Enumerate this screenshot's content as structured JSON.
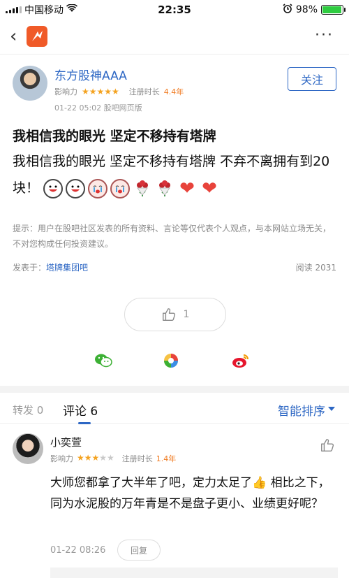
{
  "status_bar": {
    "carrier": "中国移动",
    "time": "22:35",
    "battery": "98%",
    "battery_level": 0.98
  },
  "nav": {
    "back_icon": "chevron-left-icon",
    "logo_icon": "app-logo-icon",
    "more_icon": "more-dots-icon",
    "more_label": "···"
  },
  "author": {
    "name": "东方股神AAA",
    "influence_label": "影响力",
    "influence_stars": 5,
    "influence_display": "★★★★★",
    "reg_label": "注册时长",
    "reg_value": "4.4年",
    "date": "01-22 05:02",
    "source": "股吧网页版",
    "follow_label": "关注"
  },
  "post": {
    "title": "我相信我的眼光 坚定不移持有塔牌",
    "body": "我相信我的眼光 坚定不移持有塔牌 不弃不离拥有到20块！",
    "emojis": [
      "grin-icon",
      "grin-icon",
      "cry-icon",
      "cry-icon",
      "rose-icon",
      "rose-icon",
      "heart-icon",
      "heart-icon"
    ],
    "notice": "提示：用户在股吧社区发表的所有资料、言论等仅代表个人观点，与本网站立场无关，不对您构成任何投资建议。",
    "posted_in_label": "发表于：",
    "bar_name": "塔牌集团吧",
    "read_label": "阅读 2031",
    "like_count": "1"
  },
  "share": {
    "wechat_icon": "wechat-icon",
    "moments_icon": "moments-icon",
    "weibo_icon": "weibo-icon"
  },
  "tabs": {
    "forward": "转发 0",
    "comments": "评论 6",
    "sort": "智能排序"
  },
  "comment": {
    "name": "小奕萱",
    "influence_label": "影响力",
    "influence_display_on": "★★★",
    "influence_display_off": "★★",
    "influence_stars": 3,
    "reg_label": "注册时长",
    "reg_value": "1.4年",
    "text": "大师您都拿了大半年了吧，定力太足了👍 相比之下，同为水泥股的万年青是不是盘子更小、业绩更好呢？",
    "date": "01-22 08:26",
    "reply_label": "回复"
  },
  "colors": {
    "brand_blue": "#2d67c4",
    "logo_orange": "#f05a28",
    "star": "#f4a321"
  }
}
